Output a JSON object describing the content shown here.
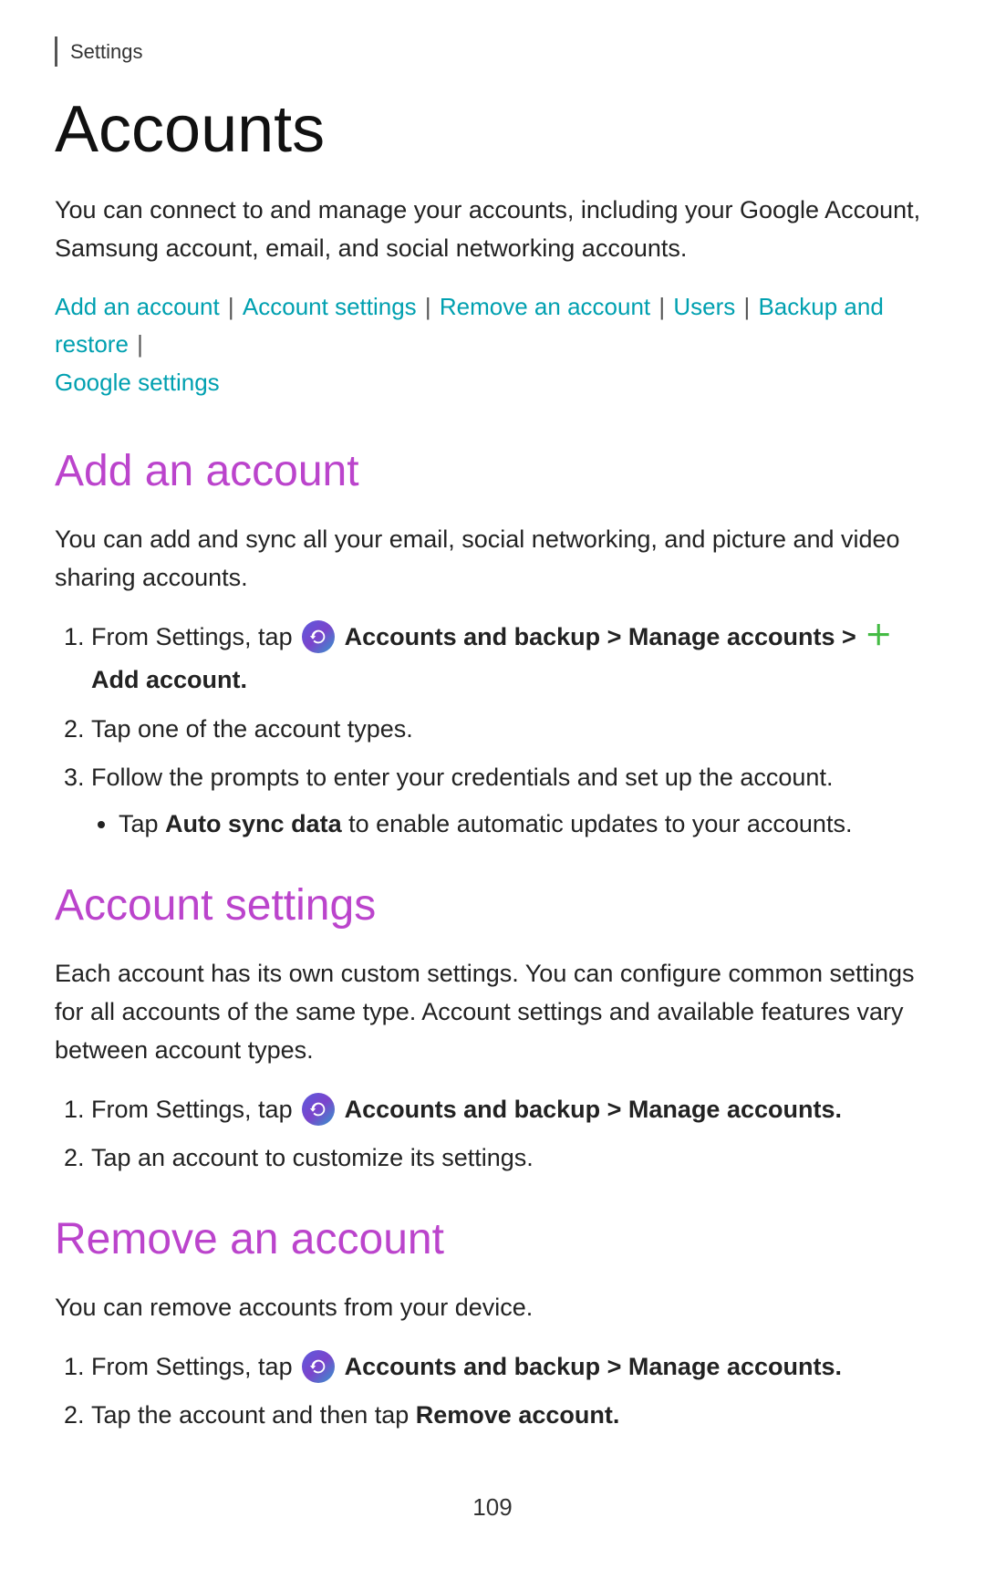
{
  "settings_label": "Settings",
  "page_title": "Accounts",
  "intro_text": "You can connect to and manage your accounts, including your Google Account, Samsung account, email, and social networking accounts.",
  "nav_links": [
    {
      "label": "Add an account",
      "id": "add-an-account"
    },
    {
      "label": "Account settings",
      "id": "account-settings"
    },
    {
      "label": "Remove an account",
      "id": "remove-an-account"
    },
    {
      "label": "Users",
      "id": "users"
    },
    {
      "label": "Backup and restore",
      "id": "backup-and-restore"
    },
    {
      "label": "Google settings",
      "id": "google-settings"
    }
  ],
  "sections": [
    {
      "id": "add-an-account",
      "title": "Add an account",
      "description": "You can add and sync all your email, social networking, and picture and video sharing accounts.",
      "steps": [
        {
          "text_before": "From Settings, tap",
          "icon": true,
          "text_bold": "Accounts and backup > Manage accounts >",
          "text_bold2": "Add account.",
          "has_plus": true
        },
        {
          "text": "Tap one of the account types."
        },
        {
          "text": "Follow the prompts to enter your credentials and set up the account.",
          "sub": [
            "Tap Auto sync data to enable automatic updates to your accounts."
          ]
        }
      ]
    },
    {
      "id": "account-settings",
      "title": "Account settings",
      "description": "Each account has its own custom settings. You can configure common settings for all accounts of the same type. Account settings and available features vary between account types.",
      "steps": [
        {
          "text_before": "From Settings, tap",
          "icon": true,
          "text_bold": "Accounts and backup > Manage accounts."
        },
        {
          "text": "Tap an account to customize its settings."
        }
      ]
    },
    {
      "id": "remove-an-account",
      "title": "Remove an account",
      "description": "You can remove accounts from your device.",
      "steps": [
        {
          "text_before": "From Settings, tap",
          "icon": true,
          "text_bold": "Accounts and backup > Manage accounts."
        },
        {
          "text_before": "Tap the account and then tap",
          "text_bold": "Remove account."
        }
      ]
    }
  ],
  "page_number": "109",
  "labels": {
    "from_settings_tap": "From Settings, tap",
    "tap_the_account": "Tap the account and then tap"
  }
}
